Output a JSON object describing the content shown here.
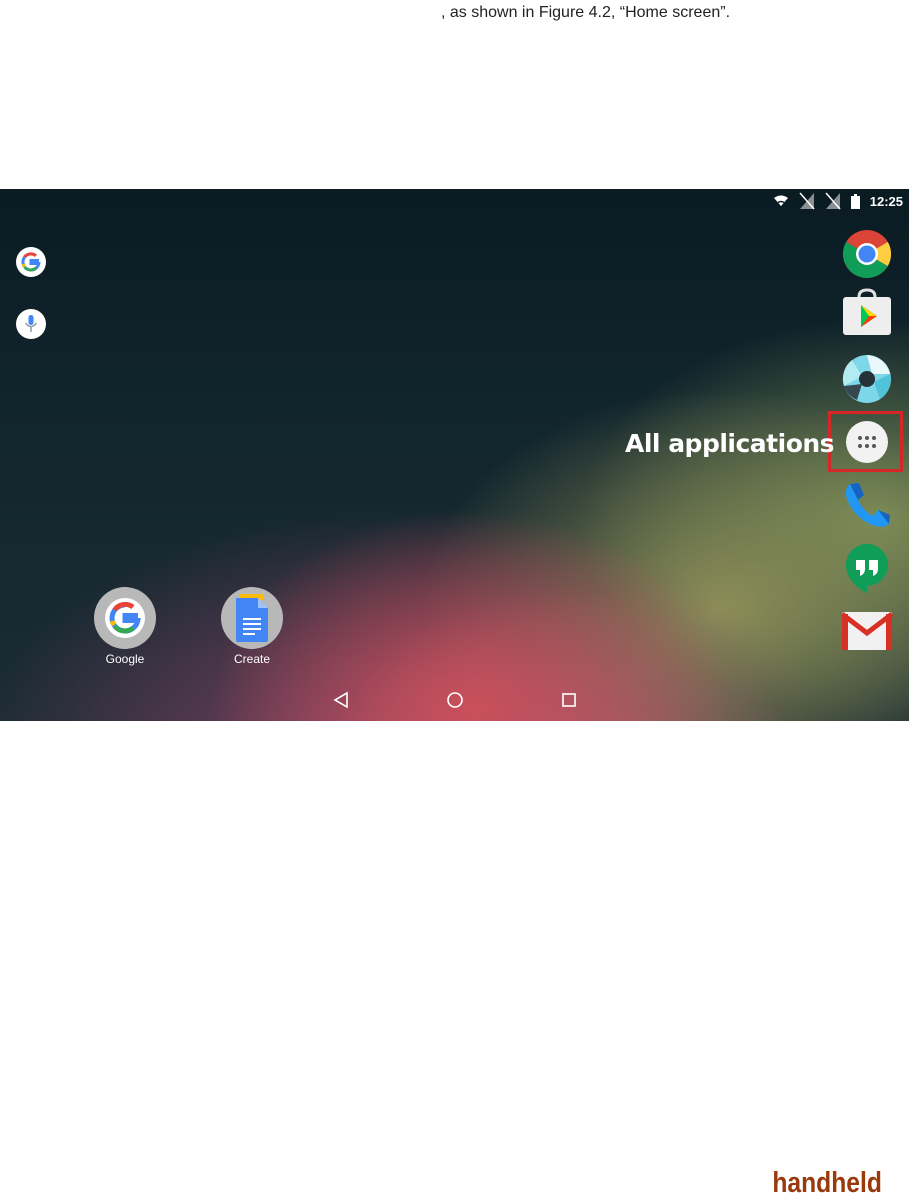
{
  "doc": {
    "caption": ", as shown in Figure 4.2, “Home screen”.",
    "brand": "handheld"
  },
  "screen": {
    "status_time": "12:25",
    "status_icons": [
      "wifi-icon",
      "no-sim-icon",
      "no-sim-icon",
      "battery-icon"
    ],
    "left_buttons": [
      "google-search-icon",
      "microphone-icon"
    ],
    "dock": [
      "chrome-icon",
      "play-store-icon",
      "camera-icon",
      "all-apps-icon",
      "phone-icon",
      "hangouts-icon",
      "gmail-icon"
    ],
    "annotation": "All applications",
    "highlight_color": "#d42828",
    "apps": [
      {
        "label": "Google",
        "icon": "google-folder-icon"
      },
      {
        "label": "Create",
        "icon": "docs-folder-icon"
      }
    ],
    "nav": [
      "back-icon",
      "home-icon",
      "recents-icon"
    ]
  }
}
